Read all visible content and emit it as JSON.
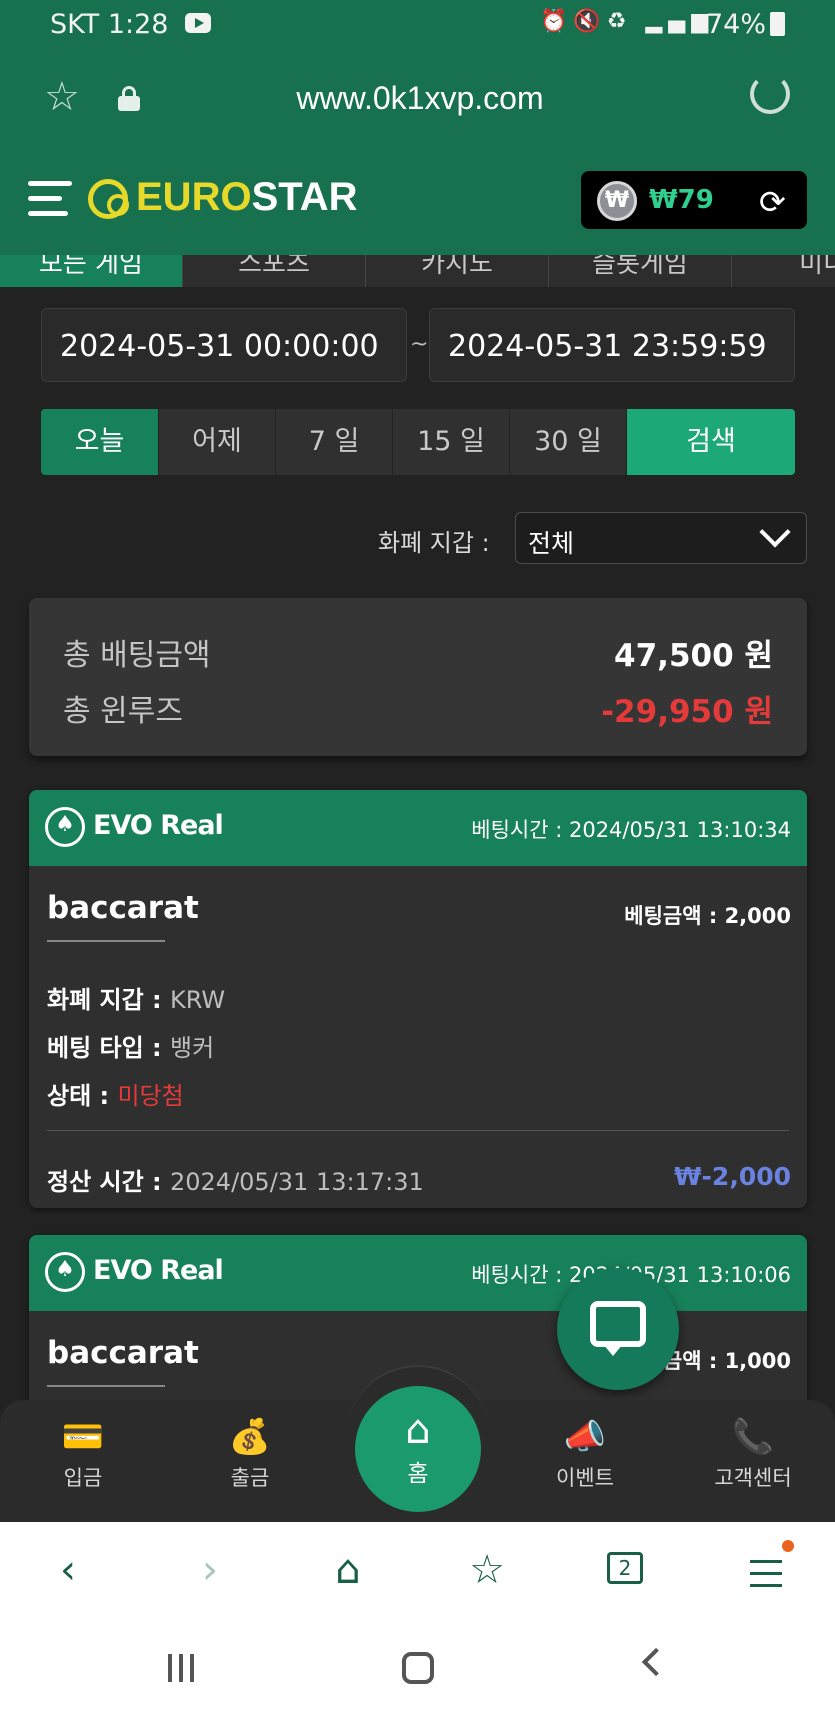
{
  "status_bar": {
    "carrier_time": "SKT 1:28",
    "battery": "74%"
  },
  "browser": {
    "url": "www.0k1xvp.com"
  },
  "header": {
    "logo_euro": "EURO",
    "logo_star": "STAR",
    "wallet_amount": "₩79",
    "wallet_coin": "₩"
  },
  "tabs": [
    "모든 게임",
    "스포츠",
    "카지노",
    "슬롯게임",
    "미니"
  ],
  "date_range": {
    "start": "2024-05-31 00:00:00",
    "end": "2024-05-31 23:59:59",
    "separator": "~"
  },
  "periods": [
    "오늘",
    "어제",
    "7 일",
    "15 일",
    "30 일"
  ],
  "search_label": "검색",
  "currency_filter": {
    "label": "화폐 지갑 :",
    "value": "전체"
  },
  "summary": {
    "total_bet_label": "총 배팅금액",
    "total_bet_value": "47,500 원",
    "total_winloss_label": "총 윈루즈",
    "total_winloss_value": "-29,950 원"
  },
  "bets": [
    {
      "provider": "EVO Real",
      "bet_time": "베팅시간 : 2024/05/31 13:10:34",
      "game": "baccarat",
      "amount": "베팅금액 : 2,000",
      "currency_label": "화폐 지갑 : ",
      "currency_value": "KRW",
      "type_label": "베팅 타입 : ",
      "type_value": "뱅커",
      "status_label": "상태 : ",
      "status_value": "미당첨",
      "settle_label": "정산 시간 : ",
      "settle_value": "2024/05/31 13:17:31",
      "profit": "₩-2,000"
    },
    {
      "provider": "EVO Real",
      "bet_time": "베팅시간 : 2024/05/31 13:10:06",
      "game": "baccarat",
      "amount": "금액 : 1,000"
    }
  ],
  "bottom_nav": {
    "deposit": "입금",
    "withdraw": "출금",
    "home": "홈",
    "event": "이벤트",
    "support": "고객센터"
  },
  "browser_tabs_count": "2",
  "colors": {
    "brand_green": "#17704e",
    "accent_green": "#1ca877",
    "loss_red": "#e53a3a",
    "profit_blue": "#6b83e0",
    "logo_yellow": "#e7d92a"
  }
}
